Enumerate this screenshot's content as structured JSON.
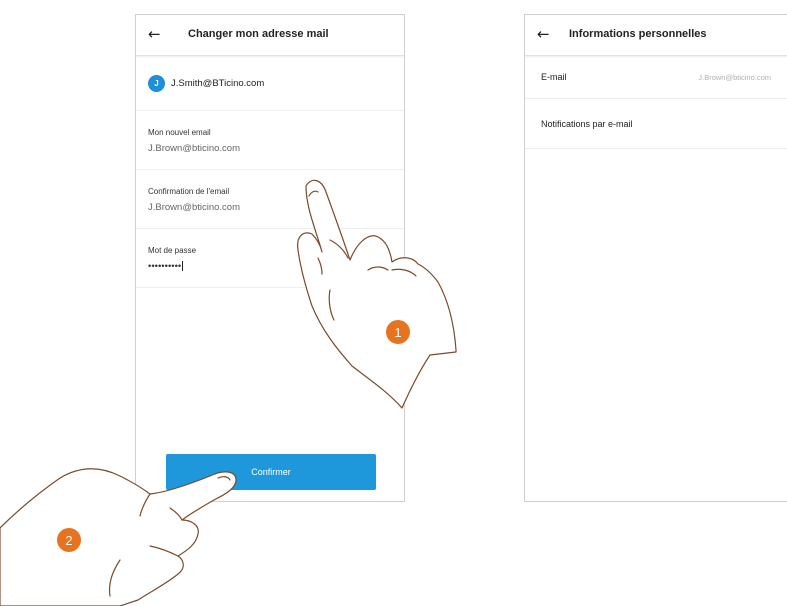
{
  "left_screen": {
    "title": "Changer mon adresse mail",
    "back_icon": "arrow-left-icon",
    "account": {
      "avatar_letter": "J",
      "email": "J.Smith@BTicino.com"
    },
    "fields": [
      {
        "label": "Mon nouvel email",
        "value": "J.Brown@bticino.com"
      },
      {
        "label": "Confirmation de l'email",
        "value": "J.Brown@bticino.com"
      },
      {
        "label": "Mot de passe",
        "value": "••••••••••"
      }
    ],
    "confirm_label": "Confirmer"
  },
  "right_screen": {
    "title": "Informations personnelles",
    "back_icon": "arrow-left-icon",
    "rows": [
      {
        "label": "E-mail",
        "value": "J.Brown@bticino.com"
      },
      {
        "label": "Notifications par e-mail"
      }
    ]
  },
  "step_badges": [
    "1",
    "2"
  ],
  "colors": {
    "accent": "#1e98db",
    "avatar": "#1e8fd8",
    "badge": "#e8731f"
  }
}
